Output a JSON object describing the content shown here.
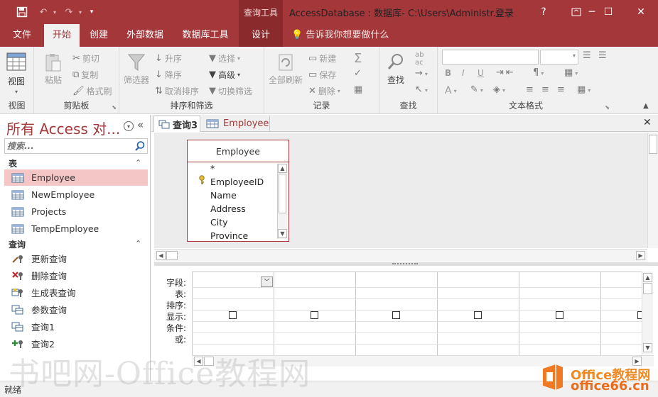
{
  "titlebar": {
    "context_tools": "查询工具",
    "title": "AccessDatabase : 数据库- C:\\Users\\Administr...",
    "login": "登录",
    "help": "?",
    "minimize": "─",
    "maximize": "☐",
    "close": "✕"
  },
  "ribbon_tabs": [
    "文件",
    "开始",
    "创建",
    "外部数据",
    "数据库工具",
    "设计"
  ],
  "tell_me": "告诉我你想要做什么",
  "ribbon": {
    "view": {
      "label": "视图",
      "group": "视图"
    },
    "clipboard": {
      "paste": "粘贴",
      "cut": "剪切",
      "copy": "复制",
      "format_painter": "格式刷",
      "group": "剪贴板"
    },
    "sort_filter": {
      "filter": "筛选器",
      "ascending": "升序",
      "descending": "降序",
      "remove_sort": "取消排序",
      "selection": "选择",
      "advanced": "高级",
      "toggle_filter": "切换筛选",
      "group": "排序和筛选"
    },
    "records": {
      "refresh_all": "全部刷新",
      "new": "新建",
      "save": "保存",
      "delete": "删除",
      "group": "记录"
    },
    "find": {
      "find": "查找",
      "group": "查找"
    },
    "text_format": {
      "bold": "B",
      "italic": "I",
      "underline": "U",
      "font_color": "A",
      "group": "文本格式"
    }
  },
  "nav": {
    "title": "所有 Access 对...",
    "search_placeholder": "搜索...",
    "groups": [
      {
        "label": "表",
        "items": [
          "Employee",
          "NewEmployee",
          "Projects",
          "TempEmployee"
        ]
      },
      {
        "label": "查询",
        "items": [
          "更新查询",
          "删除查询",
          "生成表查询",
          "参数查询",
          "查询1",
          "查询2"
        ]
      }
    ],
    "selected": "Employee"
  },
  "doc_tabs": [
    "查询3",
    "Employee"
  ],
  "table_box": {
    "title": "Employee",
    "fields": [
      "*",
      "EmployeeID",
      "Name",
      "Address",
      "City",
      "Province"
    ],
    "key_field": "EmployeeID"
  },
  "grid": {
    "row_labels": [
      "字段:",
      "表:",
      "排序:",
      "显示:",
      "条件:",
      "或:"
    ],
    "column_count": 6,
    "show_checked": [
      false,
      false,
      false,
      false,
      false,
      false
    ]
  },
  "status": "就绪",
  "watermark": {
    "main": "书吧网-Office教程网",
    "brand_top": "Office教程网",
    "brand_bottom": "office66.cn"
  },
  "colors": {
    "accent": "#a4373a",
    "selection": "#f4c6c6",
    "ribbon": "#f1f1f1"
  }
}
